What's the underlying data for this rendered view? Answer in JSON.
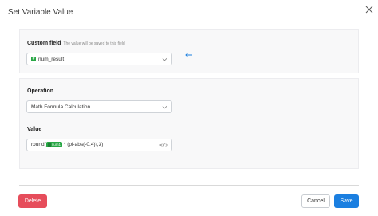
{
  "dialog": {
    "title": "Set Variable Value"
  },
  "custom_field": {
    "label": "Custom field",
    "hint": "The value will be saved to this field",
    "value": "num_result",
    "value_icon": "hash-icon"
  },
  "operation": {
    "label": "Operation",
    "value": "Math Formula Calculation"
  },
  "value_field": {
    "label": "Value",
    "prefix": "round(",
    "token": "num1",
    "suffix": " * (pi-abs(-0.4)),3)"
  },
  "footer": {
    "delete_label": "Delete",
    "cancel_label": "Cancel",
    "save_label": "Save"
  },
  "colors": {
    "delete": "#e64d5b",
    "save": "#1b7fe0",
    "token": "#28a745"
  }
}
